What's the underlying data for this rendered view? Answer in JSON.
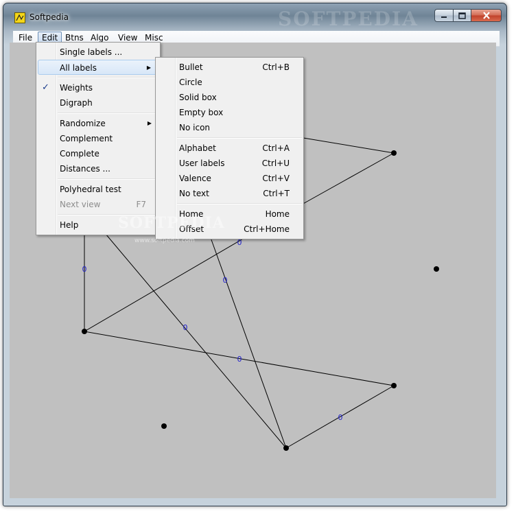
{
  "window": {
    "title": "Softpedia",
    "title_watermark": "SOFTPEDIA",
    "controls": {
      "minimize": "minimize-icon",
      "maximize": "maximize-icon",
      "close": "close-icon"
    }
  },
  "menubar": {
    "items": [
      {
        "label": "File"
      },
      {
        "label": "Edit",
        "active": true
      },
      {
        "label": "Btns"
      },
      {
        "label": "Algo"
      },
      {
        "label": "View"
      },
      {
        "label": "Misc"
      }
    ]
  },
  "edit_menu": {
    "items": [
      {
        "label": "Single labels ..."
      },
      {
        "label": "All labels",
        "submenu": true,
        "highlighted": true
      },
      {
        "label": "Weights",
        "checked": true
      },
      {
        "label": "Digraph"
      },
      {
        "label": "Randomize",
        "submenu": true
      },
      {
        "label": "Complement"
      },
      {
        "label": "Complete"
      },
      {
        "label": "Distances ..."
      },
      {
        "label": "Polyhedral test"
      },
      {
        "label": "Next view",
        "shortcut": "F7",
        "disabled": true
      },
      {
        "label": "Help"
      }
    ]
  },
  "labels_submenu": {
    "items": [
      {
        "label": "Bullet",
        "shortcut": "Ctrl+B"
      },
      {
        "label": "Circle",
        "shortcut": ""
      },
      {
        "label": "Solid box",
        "shortcut": ""
      },
      {
        "label": "Empty box",
        "shortcut": ""
      },
      {
        "label": "No icon",
        "shortcut": ""
      },
      {
        "label": "Alphabet",
        "shortcut": "Ctrl+A"
      },
      {
        "label": "User labels",
        "shortcut": "Ctrl+U"
      },
      {
        "label": "Valence",
        "shortcut": "Ctrl+V"
      },
      {
        "label": "No text",
        "shortcut": "Ctrl+T"
      },
      {
        "label": "Home",
        "shortcut": "Home"
      },
      {
        "label": "Offset",
        "shortcut": "Ctrl+Home"
      }
    ]
  },
  "graph": {
    "edge_weight_label": "0",
    "edge_label_color": "#1f1fcc",
    "background": "#c0c0c0"
  },
  "watermark": {
    "text": "SOFTPEDIA",
    "sub": "www.softpedia.com"
  }
}
